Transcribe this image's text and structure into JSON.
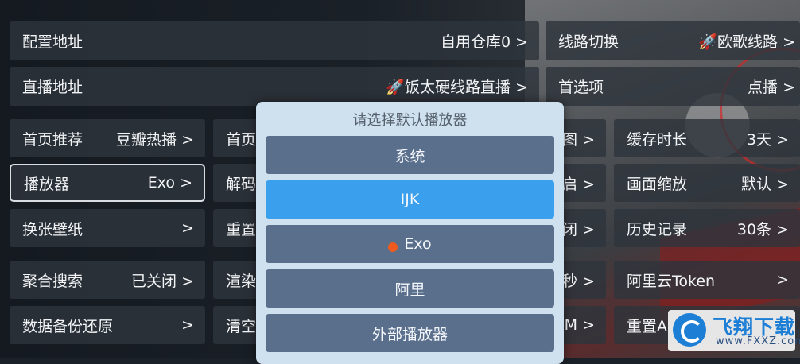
{
  "rows": {
    "config_addr": {
      "label": "配置地址",
      "value": "自用仓库0 >"
    },
    "line_switch": {
      "label": "线路切换",
      "value": "🚀欧歌线路 >"
    },
    "live_addr": {
      "label": "直播地址",
      "value": "🚀饭太硬线路直播 >"
    },
    "preferred": {
      "label": "首选项",
      "value": "点播 >"
    },
    "home_rec": {
      "label": "首页推荐",
      "value": "豆瓣热播 >"
    },
    "home2": {
      "label": "首页"
    },
    "pic_partial": {
      "value": "图 >"
    },
    "cache_time": {
      "label": "缓存时长",
      "value": "3天 >"
    },
    "player": {
      "label": "播放器",
      "value": "Exo >"
    },
    "decode": {
      "label": "解码"
    },
    "open_partial": {
      "value": "启 >"
    },
    "scale": {
      "label": "画面缩放",
      "value": "默认 >"
    },
    "wallpaper": {
      "label": "换张壁纸",
      "value": ">"
    },
    "reset": {
      "label": "重置"
    },
    "close_partial": {
      "value": "闭 >"
    },
    "history": {
      "label": "历史记录",
      "value": "30条 >"
    },
    "agg_search": {
      "label": "聚合搜索",
      "value": "已关闭 >"
    },
    "render": {
      "label": "渲染"
    },
    "sec_partial": {
      "value": "秒 >"
    },
    "ali_token": {
      "label": "阿里云Token",
      "value": ">"
    },
    "backup": {
      "label": "数据备份还原",
      "value": ">"
    },
    "clear": {
      "label": "清空"
    },
    "om_partial": {
      "value": "OM >"
    },
    "reset_a": {
      "label": "重置A"
    }
  },
  "dialog": {
    "title": "请选择默认播放器",
    "options": [
      "系统",
      "IJK",
      "Exo",
      "阿里",
      "外部播放器"
    ],
    "selected_index": 1,
    "current_index": 2
  },
  "watermark": {
    "title": "飞翔下载",
    "url": "www.FXXZ.com"
  },
  "colors": {
    "dialog_bg": "#cfe1ee",
    "option_bg": "#5a6f8c",
    "option_selected": "#3aa0ee",
    "current_dot": "#ef5a1f"
  }
}
